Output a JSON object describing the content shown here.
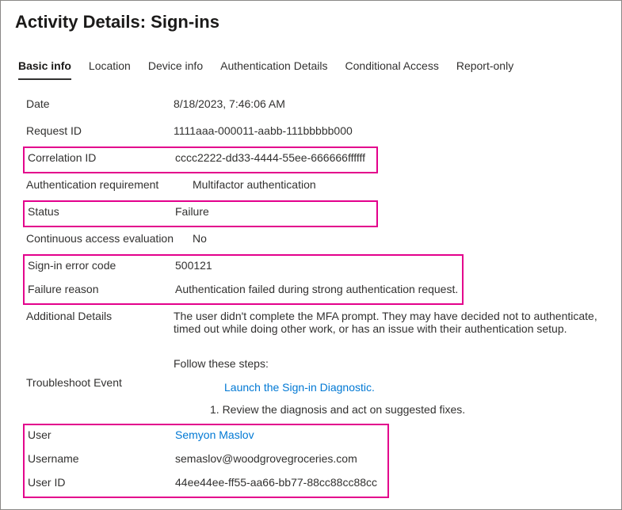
{
  "title": "Activity Details: Sign-ins",
  "tabs": {
    "basic": "Basic info",
    "location": "Location",
    "device": "Device info",
    "auth": "Authentication Details",
    "conditional": "Conditional Access",
    "report": "Report-only"
  },
  "labels": {
    "date": "Date",
    "requestId": "Request ID",
    "correlationId": "Correlation ID",
    "authReq": "Authentication requirement",
    "status": "Status",
    "cae": "Continuous access evaluation",
    "errorCode": "Sign-in error code",
    "failureReason": "Failure reason",
    "additional": "Additional Details",
    "troubleshoot": "Troubleshoot Event",
    "user": "User",
    "username": "Username",
    "userId": "User ID"
  },
  "values": {
    "date": "8/18/2023, 7:46:06 AM",
    "requestId": "1111aaa-000011-aabb-111bbbbb000",
    "correlationId": "cccc2222-dd33-4444-55ee-666666ffffff",
    "authReq": "Multifactor authentication",
    "status": "Failure",
    "cae": "No",
    "errorCode": "500121",
    "failureReason": "Authentication failed during strong authentication request.",
    "additional": "The user didn't complete the MFA prompt. They may have decided not to authenticate, timed out while doing other work, or has an issue with their authentication setup.",
    "followSteps": "Follow these steps:",
    "launchLink": "Launch the Sign-in Diagnostic.",
    "reviewStep": "1. Review the diagnosis and act on suggested fixes.",
    "user": "Semyon Maslov",
    "username": "semaslov@woodgrovegroceries.com",
    "userId": "44ee44ee-ff55-aa66-bb77-88cc88cc88cc"
  }
}
